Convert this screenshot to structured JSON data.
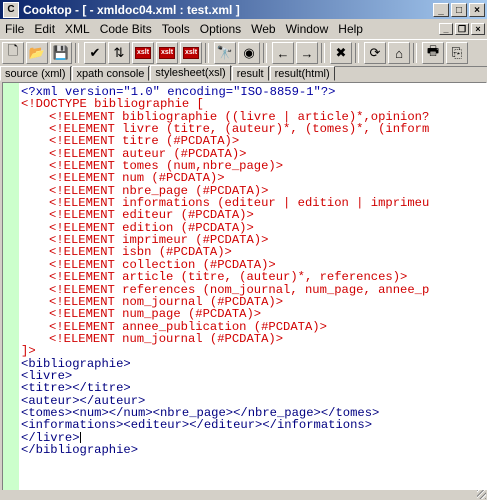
{
  "window": {
    "title": "Cooktop - [ - xmldoc04.xml : test.xml ]",
    "app_icon": "C",
    "controls": {
      "minimize": "_",
      "maximize": "□",
      "close": "×"
    }
  },
  "menubar": {
    "items": [
      "File",
      "Edit",
      "XML",
      "Code Bits",
      "Tools",
      "Options",
      "Web",
      "Window",
      "Help"
    ],
    "mdi_controls": {
      "minimize": "_",
      "restore": "❐",
      "close": "×"
    }
  },
  "toolbar": {
    "buttons": [
      {
        "name": "new",
        "icon": "🗋"
      },
      {
        "name": "open",
        "icon": "📂"
      },
      {
        "name": "save",
        "icon": "💾"
      },
      {
        "name": "validate-check",
        "icon": "✔"
      },
      {
        "name": "sort",
        "icon": "⇅"
      },
      {
        "name": "xslt-1",
        "icon": "xslt"
      },
      {
        "name": "xslt-2",
        "icon": "xslt"
      },
      {
        "name": "xslt-3",
        "icon": "xslt"
      },
      {
        "name": "find",
        "icon": "🔭"
      },
      {
        "name": "browser",
        "icon": "◉"
      },
      {
        "name": "back",
        "icon": "←"
      },
      {
        "name": "forward",
        "icon": "→"
      },
      {
        "name": "stop",
        "icon": "✖"
      },
      {
        "name": "refresh",
        "icon": "⟳"
      },
      {
        "name": "home",
        "icon": "⌂"
      },
      {
        "name": "print",
        "icon": "🖶"
      },
      {
        "name": "copy",
        "icon": "⎘"
      }
    ]
  },
  "tabs": [
    "source (xml)",
    "xpath console",
    "stylesheet(xsl)",
    "result",
    "result(html)"
  ],
  "active_tab": "stylesheet(xsl)",
  "editor": {
    "lines": [
      {
        "style": "l1",
        "text": "<?xml version=\"1.0\" encoding=\"ISO-8859-1\"?>"
      },
      {
        "style": "l2",
        "text": "<!DOCTYPE bibliographie ["
      },
      {
        "style": "l3",
        "text": "<!ELEMENT bibliographie ((livre | article)*,opinion?"
      },
      {
        "style": "l3",
        "text": "<!ELEMENT livre (titre, (auteur)*, (tomes)*, (inform"
      },
      {
        "style": "l3",
        "text": "<!ELEMENT titre (#PCDATA)>"
      },
      {
        "style": "l3",
        "text": "<!ELEMENT auteur (#PCDATA)>"
      },
      {
        "style": "l3",
        "text": "<!ELEMENT tomes (num,nbre_page)>"
      },
      {
        "style": "l3",
        "text": "<!ELEMENT num (#PCDATA)>"
      },
      {
        "style": "l3",
        "text": "<!ELEMENT nbre_page (#PCDATA)>"
      },
      {
        "style": "l3",
        "text": "<!ELEMENT informations (editeur | edition | imprimeu"
      },
      {
        "style": "l3",
        "text": "<!ELEMENT editeur (#PCDATA)>"
      },
      {
        "style": "l3",
        "text": "<!ELEMENT edition (#PCDATA)>"
      },
      {
        "style": "l3",
        "text": "<!ELEMENT imprimeur (#PCDATA)>"
      },
      {
        "style": "l3",
        "text": "<!ELEMENT isbn (#PCDATA)>"
      },
      {
        "style": "l3",
        "text": "<!ELEMENT collection (#PCDATA)>"
      },
      {
        "style": "l3",
        "text": "<!ELEMENT article (titre, (auteur)*, references)>"
      },
      {
        "style": "l3",
        "text": "<!ELEMENT references (nom_journal, num_page, annee_p"
      },
      {
        "style": "l3",
        "text": "<!ELEMENT nom_journal (#PCDATA)>"
      },
      {
        "style": "l3",
        "text": "<!ELEMENT num_page (#PCDATA)>"
      },
      {
        "style": "l3",
        "text": "<!ELEMENT annee_publication (#PCDATA)>"
      },
      {
        "style": "l3",
        "text": "<!ELEMENT num_journal (#PCDATA)>"
      },
      {
        "style": "l2",
        "text": "]>"
      },
      {
        "style": "l4",
        "text": "<bibliographie>"
      },
      {
        "style": "l4",
        "text": "<livre>"
      },
      {
        "style": "l4",
        "text": "<titre></titre>"
      },
      {
        "style": "l4",
        "text": "<auteur></auteur>"
      },
      {
        "style": "l4",
        "text": "<tomes><num></num><nbre_page></nbre_page></tomes>"
      },
      {
        "style": "l4",
        "text": "<informations><editeur></editeur></informations>"
      },
      {
        "style": "l4",
        "text": "</livre>",
        "caret": true
      },
      {
        "style": "l4",
        "text": "</bibliographie>"
      }
    ]
  }
}
